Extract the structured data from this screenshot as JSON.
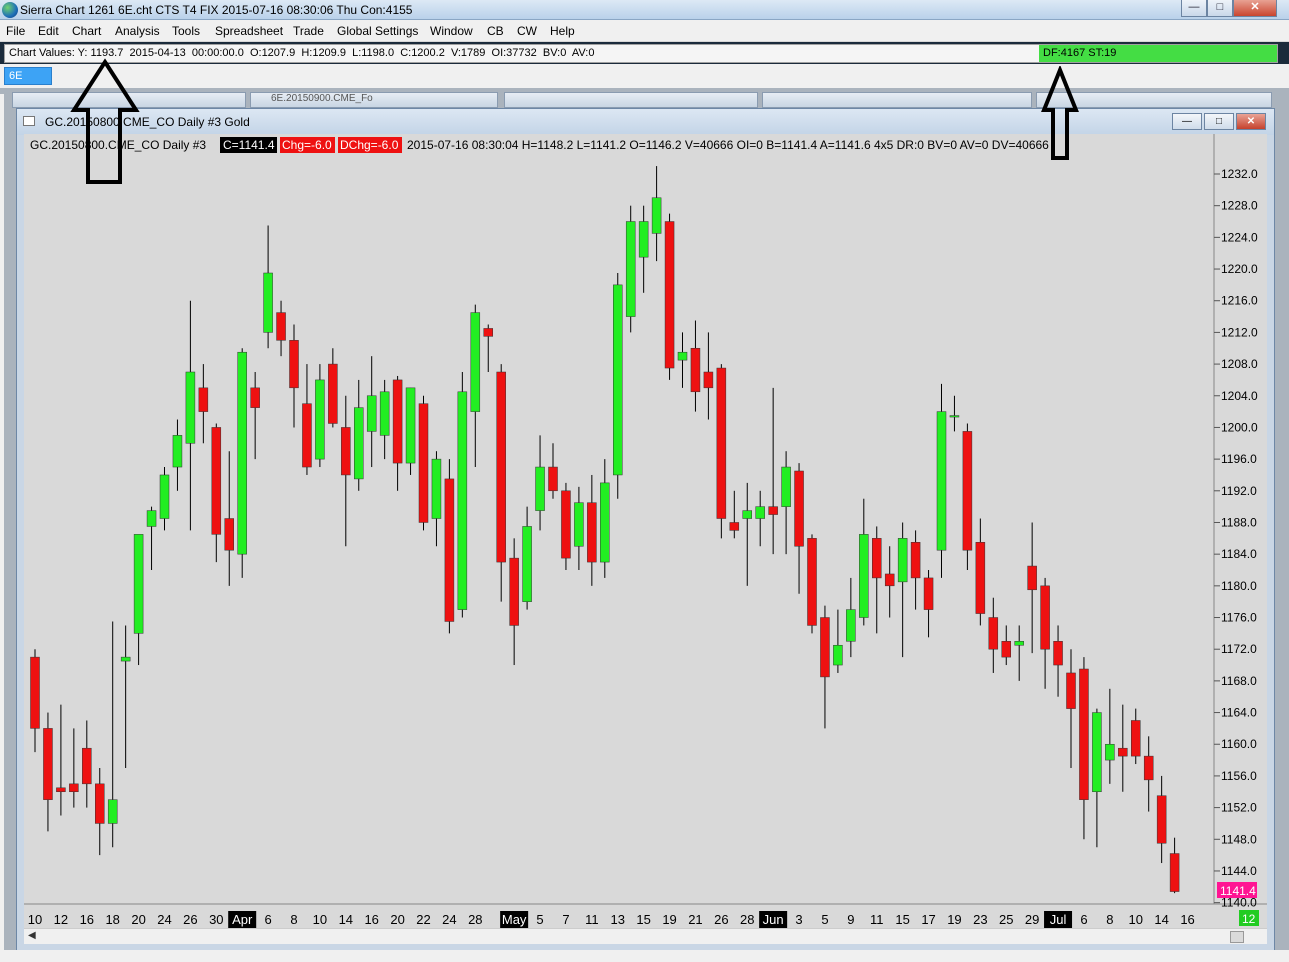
{
  "app": {
    "title": "Sierra Chart 1261 6E.cht  CTS T4 FIX 2015-07-16  08:30:06 Thu   Con:4155",
    "minimize": "—",
    "maximize": "□",
    "close": "✕"
  },
  "menu": [
    "File",
    "Edit",
    "Chart",
    "Analysis",
    "Tools",
    "Spreadsheet",
    "Trade",
    "Global Settings",
    "Window",
    "CB",
    "CW",
    "Help"
  ],
  "chart_values_bar": {
    "text": "Chart Values: Y: 1193.7  2015-04-13  00:00:00.0  O:1207.9  H:1209.9  L:1198.0  C:1200.2  V:1789  OI:37732  BV:0  AV:0",
    "df_status": "DF:4167  ST:19"
  },
  "symbol_tab": "6E",
  "background_windows": [
    {
      "title": "6E.20150900.CME_Fo"
    }
  ],
  "chart_window": {
    "title": "GC.20150800.CME_CO  Daily  #3  Gold",
    "header": {
      "prefix": "GC.20150800.CME_CO   Daily   #3",
      "close": "C=1141.4",
      "chg": "Chg=-6.0",
      "dchg": "DChg=-6.0",
      "rest": "2015-07-16 08:30:04 H=1148.2 L=1141.2 O=1146.2 V=40666 OI=0 B=1141.4 A=1141.6 4x5 DR:0 BV=0 AV=0 DV=40666"
    },
    "last_price_label": "1141.4",
    "bottom_right_label": "12",
    "colors": {
      "up": "#22ee22",
      "down": "#ee1111",
      "background": "#d9d9d9",
      "last_price": "#ff1493",
      "header_close_bg": "#000000",
      "header_chg_bg": "#ee1111"
    }
  },
  "chart_data": {
    "type": "candlestick",
    "y_axis": {
      "min": 1141,
      "max": 1234,
      "ticks": [
        "1232.0",
        "1228.0",
        "1224.0",
        "1220.0",
        "1216.0",
        "1212.0",
        "1208.0",
        "1204.0",
        "1200.0",
        "1196.0",
        "1192.0",
        "1188.0",
        "1184.0",
        "1180.0",
        "1176.0",
        "1172.0",
        "1168.0",
        "1164.0",
        "1160.0",
        "1156.0",
        "1152.0",
        "1148.0",
        "1144.0",
        "1140.0"
      ]
    },
    "x_labels": [
      {
        "i": 0,
        "t": "10"
      },
      {
        "i": 2,
        "t": "12"
      },
      {
        "i": 4,
        "t": "16"
      },
      {
        "i": 6,
        "t": "18"
      },
      {
        "i": 8,
        "t": "20"
      },
      {
        "i": 10,
        "t": "24"
      },
      {
        "i": 12,
        "t": "26"
      },
      {
        "i": 14,
        "t": "30"
      },
      {
        "i": 16,
        "t": "Apr",
        "month": true
      },
      {
        "i": 18,
        "t": "6"
      },
      {
        "i": 20,
        "t": "8"
      },
      {
        "i": 22,
        "t": "10"
      },
      {
        "i": 24,
        "t": "14"
      },
      {
        "i": 26,
        "t": "16"
      },
      {
        "i": 28,
        "t": "20"
      },
      {
        "i": 30,
        "t": "22"
      },
      {
        "i": 32,
        "t": "24"
      },
      {
        "i": 34,
        "t": "28"
      },
      {
        "i": 37,
        "t": "May",
        "month": true
      },
      {
        "i": 39,
        "t": "5"
      },
      {
        "i": 41,
        "t": "7"
      },
      {
        "i": 43,
        "t": "11"
      },
      {
        "i": 45,
        "t": "13"
      },
      {
        "i": 47,
        "t": "15"
      },
      {
        "i": 49,
        "t": "19"
      },
      {
        "i": 51,
        "t": "21"
      },
      {
        "i": 53,
        "t": "26"
      },
      {
        "i": 55,
        "t": "28"
      },
      {
        "i": 57,
        "t": "Jun",
        "month": true
      },
      {
        "i": 59,
        "t": "3"
      },
      {
        "i": 61,
        "t": "5"
      },
      {
        "i": 63,
        "t": "9"
      },
      {
        "i": 65,
        "t": "11"
      },
      {
        "i": 67,
        "t": "15"
      },
      {
        "i": 69,
        "t": "17"
      },
      {
        "i": 71,
        "t": "19"
      },
      {
        "i": 73,
        "t": "23"
      },
      {
        "i": 75,
        "t": "25"
      },
      {
        "i": 77,
        "t": "29"
      },
      {
        "i": 79,
        "t": "Jul",
        "month": true
      },
      {
        "i": 81,
        "t": "6"
      },
      {
        "i": 83,
        "t": "8"
      },
      {
        "i": 85,
        "t": "10"
      },
      {
        "i": 87,
        "t": "14"
      },
      {
        "i": 89,
        "t": "16"
      }
    ],
    "candles": [
      {
        "o": 1171.0,
        "h": 1172.0,
        "l": 1159.0,
        "c": 1162.0
      },
      {
        "o": 1162.0,
        "h": 1164.0,
        "l": 1149.0,
        "c": 1153.0
      },
      {
        "o": 1154.5,
        "h": 1165.0,
        "l": 1151.0,
        "c": 1154.0
      },
      {
        "o": 1155.0,
        "h": 1162.0,
        "l": 1152.0,
        "c": 1154.0
      },
      {
        "o": 1159.5,
        "h": 1163.0,
        "l": 1152.0,
        "c": 1155.0
      },
      {
        "o": 1155.0,
        "h": 1157.0,
        "l": 1146.0,
        "c": 1150.0
      },
      {
        "o": 1150.0,
        "h": 1175.5,
        "l": 1147.0,
        "c": 1153.0
      },
      {
        "o": 1170.5,
        "h": 1175.0,
        "l": 1157.0,
        "c": 1171.0
      },
      {
        "o": 1174.0,
        "h": 1178.0,
        "l": 1170.0,
        "c": 1186.5
      },
      {
        "o": 1187.5,
        "h": 1190.0,
        "l": 1182.0,
        "c": 1189.5
      },
      {
        "o": 1188.5,
        "h": 1195.0,
        "l": 1187.0,
        "c": 1194.0
      },
      {
        "o": 1195.0,
        "h": 1201.0,
        "l": 1192.0,
        "c": 1199.0
      },
      {
        "o": 1198.0,
        "h": 1216.0,
        "l": 1187.0,
        "c": 1207.0
      },
      {
        "o": 1205.0,
        "h": 1208.0,
        "l": 1198.0,
        "c": 1202.0
      },
      {
        "o": 1200.0,
        "h": 1200.5,
        "l": 1183.0,
        "c": 1186.5
      },
      {
        "o": 1188.5,
        "h": 1197.0,
        "l": 1180.0,
        "c": 1184.5
      },
      {
        "o": 1184.0,
        "h": 1210.0,
        "l": 1181.0,
        "c": 1209.5
      },
      {
        "o": 1205.0,
        "h": 1207.0,
        "l": 1196.0,
        "c": 1202.5
      },
      {
        "o": 1212.0,
        "h": 1225.5,
        "l": 1210.0,
        "c": 1219.5
      },
      {
        "o": 1214.5,
        "h": 1216.0,
        "l": 1209.0,
        "c": 1211.0
      },
      {
        "o": 1211.0,
        "h": 1213.0,
        "l": 1200.0,
        "c": 1205.0
      },
      {
        "o": 1203.0,
        "h": 1208.0,
        "l": 1194.0,
        "c": 1195.0
      },
      {
        "o": 1196.0,
        "h": 1208.0,
        "l": 1195.0,
        "c": 1206.0
      },
      {
        "o": 1208.0,
        "h": 1210.0,
        "l": 1200.0,
        "c": 1200.5
      },
      {
        "o": 1200.0,
        "h": 1204.0,
        "l": 1185.0,
        "c": 1194.0
      },
      {
        "o": 1193.5,
        "h": 1206.0,
        "l": 1192.0,
        "c": 1202.5
      },
      {
        "o": 1199.5,
        "h": 1209.0,
        "l": 1195.0,
        "c": 1204.0
      },
      {
        "o": 1199.0,
        "h": 1206.0,
        "l": 1196.0,
        "c": 1204.5
      },
      {
        "o": 1206.0,
        "h": 1206.5,
        "l": 1192.0,
        "c": 1195.5
      },
      {
        "o": 1195.5,
        "h": 1205.0,
        "l": 1194.0,
        "c": 1205.0
      },
      {
        "o": 1203.0,
        "h": 1204.0,
        "l": 1187.0,
        "c": 1188.0
      },
      {
        "o": 1188.5,
        "h": 1197.0,
        "l": 1185.0,
        "c": 1196.0
      },
      {
        "o": 1193.5,
        "h": 1196.0,
        "l": 1174.0,
        "c": 1175.5
      },
      {
        "o": 1177.0,
        "h": 1207.0,
        "l": 1176.0,
        "c": 1204.5
      },
      {
        "o": 1202.0,
        "h": 1215.5,
        "l": 1195.0,
        "c": 1214.5
      },
      {
        "o": 1212.5,
        "h": 1213.0,
        "l": 1207.0,
        "c": 1211.5
      },
      {
        "o": 1207.0,
        "h": 1208.0,
        "l": 1178.0,
        "c": 1183.0
      },
      {
        "o": 1183.5,
        "h": 1186.0,
        "l": 1170.0,
        "c": 1175.0
      },
      {
        "o": 1178.0,
        "h": 1190.0,
        "l": 1177.0,
        "c": 1187.5
      },
      {
        "o": 1189.5,
        "h": 1199.0,
        "l": 1187.0,
        "c": 1195.0
      },
      {
        "o": 1195.0,
        "h": 1198.0,
        "l": 1191.0,
        "c": 1192.0
      },
      {
        "o": 1192.0,
        "h": 1193.0,
        "l": 1182.0,
        "c": 1183.5
      },
      {
        "o": 1185.0,
        "h": 1192.5,
        "l": 1182.0,
        "c": 1190.5
      },
      {
        "o": 1190.5,
        "h": 1194.0,
        "l": 1180.0,
        "c": 1183.0
      },
      {
        "o": 1183.0,
        "h": 1196.0,
        "l": 1181.0,
        "c": 1193.0
      },
      {
        "o": 1194.0,
        "h": 1219.5,
        "l": 1191.0,
        "c": 1218.0
      },
      {
        "o": 1214.0,
        "h": 1228.0,
        "l": 1212.0,
        "c": 1226.0
      },
      {
        "o": 1221.5,
        "h": 1228.0,
        "l": 1217.0,
        "c": 1226.0
      },
      {
        "o": 1224.5,
        "h": 1233.0,
        "l": 1221.0,
        "c": 1229.0
      },
      {
        "o": 1226.0,
        "h": 1227.0,
        "l": 1206.0,
        "c": 1207.5
      },
      {
        "o": 1208.5,
        "h": 1212.0,
        "l": 1205.0,
        "c": 1209.5
      },
      {
        "o": 1210.0,
        "h": 1213.5,
        "l": 1202.0,
        "c": 1204.5
      },
      {
        "o": 1207.0,
        "h": 1212.0,
        "l": 1201.0,
        "c": 1205.0
      },
      {
        "o": 1207.5,
        "h": 1208.0,
        "l": 1186.0,
        "c": 1188.5
      },
      {
        "o": 1188.0,
        "h": 1192.0,
        "l": 1186.0,
        "c": 1187.0
      },
      {
        "o": 1188.5,
        "h": 1193.0,
        "l": 1180.0,
        "c": 1189.5
      },
      {
        "o": 1188.5,
        "h": 1192.0,
        "l": 1185.0,
        "c": 1190.0
      },
      {
        "o": 1190.0,
        "h": 1205.0,
        "l": 1184.0,
        "c": 1189.0
      },
      {
        "o": 1190.0,
        "h": 1197.0,
        "l": 1184.0,
        "c": 1195.0
      },
      {
        "o": 1194.5,
        "h": 1195.5,
        "l": 1179.0,
        "c": 1185.0
      },
      {
        "o": 1186.0,
        "h": 1186.5,
        "l": 1174.0,
        "c": 1175.0
      },
      {
        "o": 1176.0,
        "h": 1177.5,
        "l": 1162.0,
        "c": 1168.5
      },
      {
        "o": 1170.0,
        "h": 1177.0,
        "l": 1169.0,
        "c": 1172.5
      },
      {
        "o": 1173.0,
        "h": 1181.0,
        "l": 1171.0,
        "c": 1177.0
      },
      {
        "o": 1176.0,
        "h": 1191.0,
        "l": 1175.0,
        "c": 1186.5
      },
      {
        "o": 1186.0,
        "h": 1187.5,
        "l": 1174.0,
        "c": 1181.0
      },
      {
        "o": 1181.5,
        "h": 1185.0,
        "l": 1176.0,
        "c": 1180.0
      },
      {
        "o": 1180.5,
        "h": 1188.0,
        "l": 1171.0,
        "c": 1186.0
      },
      {
        "o": 1185.5,
        "h": 1187.0,
        "l": 1177.0,
        "c": 1181.0
      },
      {
        "o": 1181.0,
        "h": 1182.0,
        "l": 1173.5,
        "c": 1177.0
      },
      {
        "o": 1184.5,
        "h": 1205.5,
        "l": 1181.0,
        "c": 1202.0
      },
      {
        "o": 1201.5,
        "h": 1204.0,
        "l": 1199.5,
        "c": 1201.5
      },
      {
        "o": 1199.5,
        "h": 1200.5,
        "l": 1182.0,
        "c": 1184.5
      },
      {
        "o": 1185.5,
        "h": 1188.5,
        "l": 1175.0,
        "c": 1176.5
      },
      {
        "o": 1176.0,
        "h": 1178.5,
        "l": 1169.0,
        "c": 1172.0
      },
      {
        "o": 1173.0,
        "h": 1175.0,
        "l": 1170.0,
        "c": 1171.0
      },
      {
        "o": 1172.5,
        "h": 1175.0,
        "l": 1168.0,
        "c": 1173.0
      },
      {
        "o": 1182.5,
        "h": 1188.0,
        "l": 1171.5,
        "c": 1179.5
      },
      {
        "o": 1180.0,
        "h": 1181.0,
        "l": 1167.0,
        "c": 1172.0
      },
      {
        "o": 1173.0,
        "h": 1175.0,
        "l": 1166.0,
        "c": 1170.0
      },
      {
        "o": 1169.0,
        "h": 1172.0,
        "l": 1157.0,
        "c": 1164.5
      },
      {
        "o": 1169.5,
        "h": 1171.0,
        "l": 1148.0,
        "c": 1153.0
      },
      {
        "o": 1154.0,
        "h": 1164.5,
        "l": 1147.0,
        "c": 1164.0
      },
      {
        "o": 1158.0,
        "h": 1167.0,
        "l": 1155.0,
        "c": 1160.0
      },
      {
        "o": 1159.5,
        "h": 1165.0,
        "l": 1154.0,
        "c": 1158.5
      },
      {
        "o": 1163.0,
        "h": 1164.5,
        "l": 1157.5,
        "c": 1158.5
      },
      {
        "o": 1158.5,
        "h": 1161.0,
        "l": 1151.5,
        "c": 1155.5
      },
      {
        "o": 1153.5,
        "h": 1156.0,
        "l": 1145.0,
        "c": 1147.5
      },
      {
        "o": 1146.2,
        "h": 1148.2,
        "l": 1141.2,
        "c": 1141.4
      }
    ]
  }
}
